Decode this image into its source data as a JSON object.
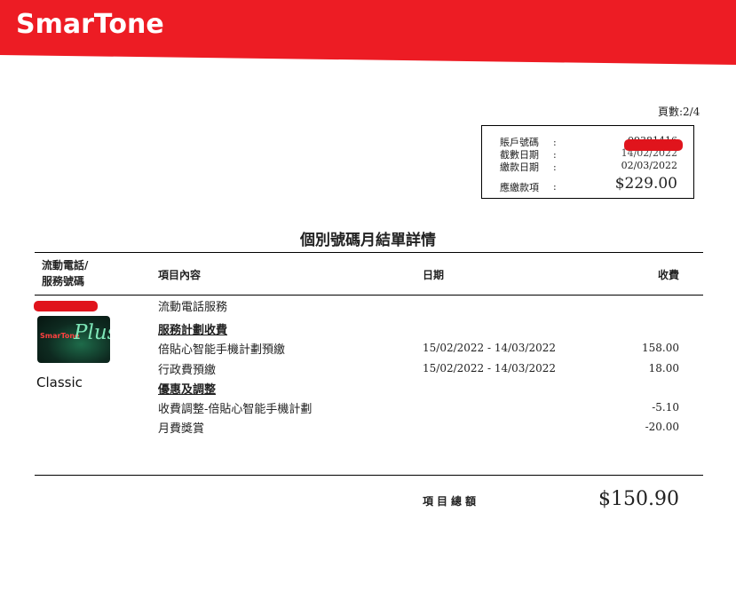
{
  "brand": {
    "logo_text": "SmarTone"
  },
  "header": {
    "page_label": "頁數:2/4"
  },
  "summary": {
    "account_no": {
      "label": "賬戶號碼",
      "value": "09381416"
    },
    "cutoff_date": {
      "label": "截數日期",
      "value": "14/02/2022"
    },
    "payment_date": {
      "label": "繳款日期",
      "value": "02/03/2022"
    },
    "amount_due": {
      "label": "應繳款項",
      "value": "$229.00"
    },
    "colon": ":"
  },
  "title": "個別號碼月結單詳情",
  "table": {
    "headers": {
      "phone_line1": "流動電話/",
      "phone_line2": "服務號碼",
      "item": "項目內容",
      "date": "日期",
      "fee": "收費"
    },
    "service_label": "流動電話服務",
    "section_charges": "服務計劃收費",
    "section_discounts": "優惠及調整",
    "rows": [
      {
        "item": "倍貼心智能手機計劃預繳",
        "date": "15/02/2022 - 14/03/2022",
        "amount": "158.00"
      },
      {
        "item": "行政費預繳",
        "date": "15/02/2022 - 14/03/2022",
        "amount": "18.00"
      },
      {
        "item": "收費調整-倍貼心智能手機計劃",
        "date": "",
        "amount": "-5.10"
      },
      {
        "item": "月費獎賞",
        "date": "",
        "amount": "-20.00"
      }
    ]
  },
  "plan": {
    "card_brand": "SmarTone",
    "card_plus": "Plus",
    "name": "Classic"
  },
  "total": {
    "label": "項目總額",
    "value": "$150.90"
  },
  "colors": {
    "brand_red": "#ed1c24",
    "redaction": "#e0141c"
  }
}
